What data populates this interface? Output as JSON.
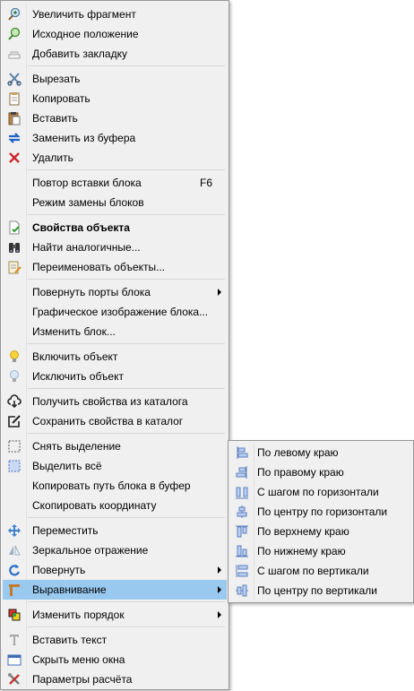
{
  "menu": {
    "items": [
      {
        "label": "Увеличить фрагмент",
        "icon": "zoom-in-icon"
      },
      {
        "label": "Исходное положение",
        "icon": "zoom-reset-icon"
      },
      {
        "label": "Добавить закладку",
        "icon": "bookmark-icon"
      },
      {
        "label": "Вырезать",
        "icon": "cut-icon"
      },
      {
        "label": "Копировать",
        "icon": "copy-icon"
      },
      {
        "label": "Вставить",
        "icon": "paste-icon"
      },
      {
        "label": "Заменить из буфера",
        "icon": "replace-icon"
      },
      {
        "label": "Удалить",
        "icon": "delete-icon"
      },
      {
        "label": "Повтор вставки блока",
        "shortcut": "F6"
      },
      {
        "label": "Режим замены блоков"
      },
      {
        "label": "Свойства объекта",
        "icon": "properties-icon"
      },
      {
        "label": "Найти аналогичные...",
        "icon": "binoculars-icon"
      },
      {
        "label": "Переименовать объекты...",
        "icon": "rename-icon"
      },
      {
        "label": "Повернуть порты блока"
      },
      {
        "label": "Графическое изображение блока..."
      },
      {
        "label": "Изменить блок..."
      },
      {
        "label": "Включить объект",
        "icon": "bulb-on-icon"
      },
      {
        "label": "Исключить объект",
        "icon": "bulb-off-icon"
      },
      {
        "label": "Получить свойства из каталога",
        "icon": "cloud-download-icon"
      },
      {
        "label": "Сохранить свойства в каталог",
        "icon": "edit-save-icon"
      },
      {
        "label": "Снять выделение",
        "icon": "deselect-icon"
      },
      {
        "label": "Выделить всё",
        "icon": "select-all-icon"
      },
      {
        "label": "Копировать путь блока в буфер"
      },
      {
        "label": "Скопировать координату"
      },
      {
        "label": "Переместить",
        "icon": "move-icon"
      },
      {
        "label": "Зеркальное отражение",
        "icon": "mirror-icon"
      },
      {
        "label": "Повернуть",
        "icon": "rotate-icon"
      },
      {
        "label": "Выравнивание",
        "icon": "align-icon"
      },
      {
        "label": "Изменить порядок",
        "icon": "order-icon"
      },
      {
        "label": "Вставить текст",
        "icon": "text-icon"
      },
      {
        "label": "Скрыть меню окна",
        "icon": "window-menu-icon"
      },
      {
        "label": "Параметры расчёта",
        "icon": "tools-icon"
      }
    ]
  },
  "submenu": {
    "items": [
      {
        "label": "По левому краю",
        "icon": "align-left-icon"
      },
      {
        "label": "По правому краю",
        "icon": "align-right-icon"
      },
      {
        "label": "С шагом по горизонтали",
        "icon": "distribute-horizontal-icon"
      },
      {
        "label": "По центру по горизонтали",
        "icon": "align-center-horizontal-icon"
      },
      {
        "label": "По верхнему краю",
        "icon": "align-top-icon"
      },
      {
        "label": "По нижнему краю",
        "icon": "align-bottom-icon"
      },
      {
        "label": "С шагом по вертикали",
        "icon": "distribute-vertical-icon"
      },
      {
        "label": "По центру по вертикали",
        "icon": "align-center-vertical-icon"
      }
    ]
  }
}
